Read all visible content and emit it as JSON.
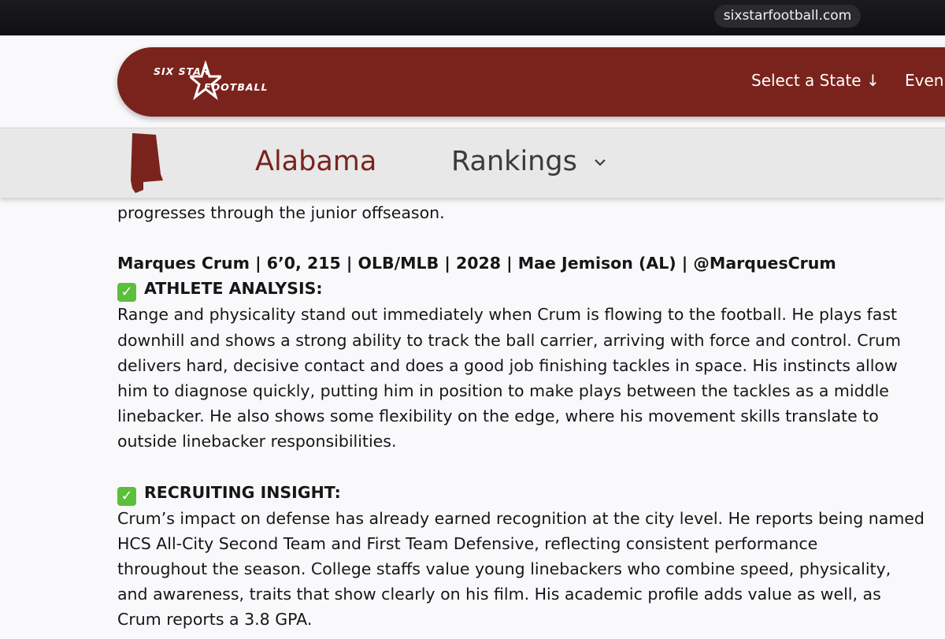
{
  "browser": {
    "url": "sixstarfootball.com"
  },
  "header": {
    "logo_line1": "SIX STAR",
    "logo_line2": "FOOTBALL",
    "nav_select_state": "Select a State ↓",
    "nav_events": "Even"
  },
  "subnav": {
    "state": "Alabama",
    "rankings": "Rankings"
  },
  "article": {
    "intro": "progresses through the junior offseason.",
    "player_line": "Marques Crum | 6’0, 215 | OLB/MLB | 2028 | Mae Jemison (AL) | @MarquesCrum",
    "section1_title": "ATHLETE ANALYSIS:",
    "section1_lines": [
      "Range and physicality stand out immediately when Crum is flowing to the football. He plays fast",
      "downhill and shows a strong ability to track the ball carrier, arriving with force and control. Crum",
      "delivers hard, decisive contact and does a good job finishing tackles in space. His instincts allow",
      "him to diagnose quickly, putting him in position to make plays between the tackles as a middle",
      "linebacker. He also shows some flexibility on the edge, where his movement skills translate to",
      "outside linebacker responsibilities."
    ],
    "section2_title": "RECRUITING INSIGHT:",
    "section2_lines": [
      "Crum’s impact on defense has already earned recognition at the city level. He reports being named",
      "HCS All-City Second Team and First Team Defensive, reflecting consistent performance",
      "throughout the season. College staffs value young linebackers who combine speed, physicality,",
      "and awareness, traits that show clearly on his film. His academic profile adds value as well, as",
      "Crum reports a 3.8 GPA."
    ],
    "check_glyph": "✓"
  },
  "colors": {
    "brand_red": "#7a231c",
    "check_green": "#5cbf3b"
  }
}
